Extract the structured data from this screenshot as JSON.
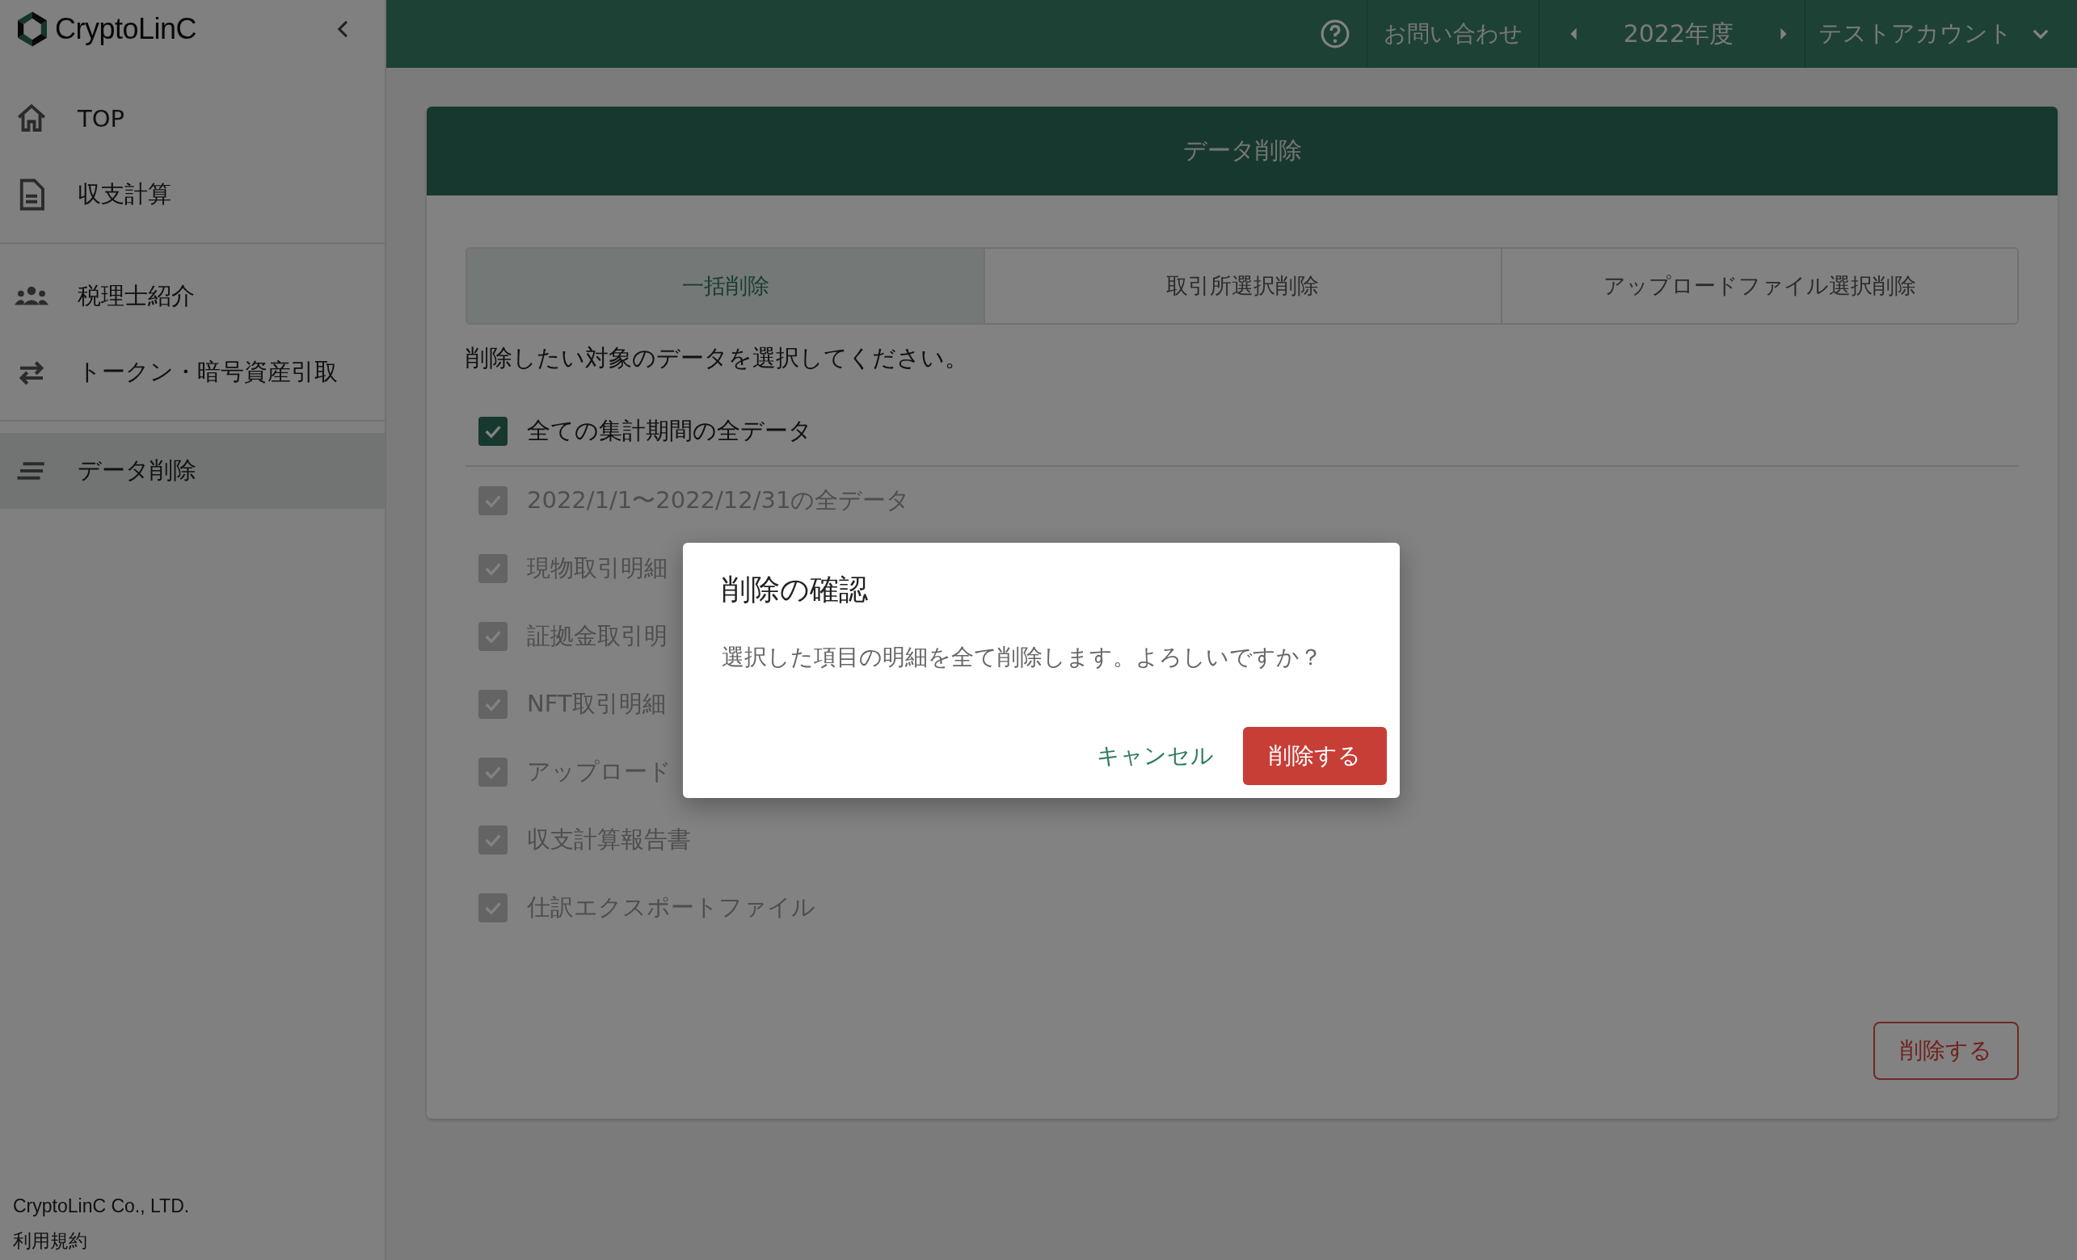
{
  "sidebar": {
    "logo": "CryptoLinC",
    "sections": [
      {
        "items": [
          {
            "label": "TOP",
            "selected": false
          },
          {
            "label": "収支計算",
            "selected": false
          }
        ]
      },
      {
        "items": [
          {
            "label": "税理士紹介",
            "selected": false
          },
          {
            "label": "トークン・暗号資産引取",
            "selected": false
          }
        ]
      },
      {
        "items": [
          {
            "label": "データ削除",
            "selected": true
          }
        ]
      }
    ],
    "footer": {
      "company": "CryptoLinC Co., LTD.",
      "terms": "利用規約"
    }
  },
  "topbar": {
    "contact": "お問い合わせ",
    "year": "2022年度",
    "account": "テストアカウント"
  },
  "card": {
    "title": "データ削除",
    "tabs": [
      {
        "label": "一括削除",
        "selected": true
      },
      {
        "label": "取引所選択削除",
        "selected": false
      },
      {
        "label": "アップロードファイル選択削除",
        "selected": false
      }
    ],
    "instruction": "削除したい対象のデータを選択してください。",
    "options": [
      {
        "label": "全ての集計期間の全データ",
        "checked": true,
        "disabled": false
      },
      {
        "label": "2022/1/1〜2022/12/31の全データ",
        "checked": true,
        "disabled": true
      },
      {
        "label": "現物取引明細",
        "checked": true,
        "disabled": true
      },
      {
        "label": "証拠金取引明",
        "checked": true,
        "disabled": true
      },
      {
        "label": "NFT取引明細",
        "checked": true,
        "disabled": true
      },
      {
        "label": "アップロード",
        "checked": true,
        "disabled": true
      },
      {
        "label": "収支計算報告書",
        "checked": true,
        "disabled": true
      },
      {
        "label": "仕訳エクスポートファイル",
        "checked": true,
        "disabled": true
      }
    ],
    "delete_button": "削除する"
  },
  "dialog": {
    "title": "削除の確認",
    "message": "選択した項目の明細を全て削除します。よろしいですか？",
    "cancel": "キャンセル",
    "confirm": "削除する"
  }
}
